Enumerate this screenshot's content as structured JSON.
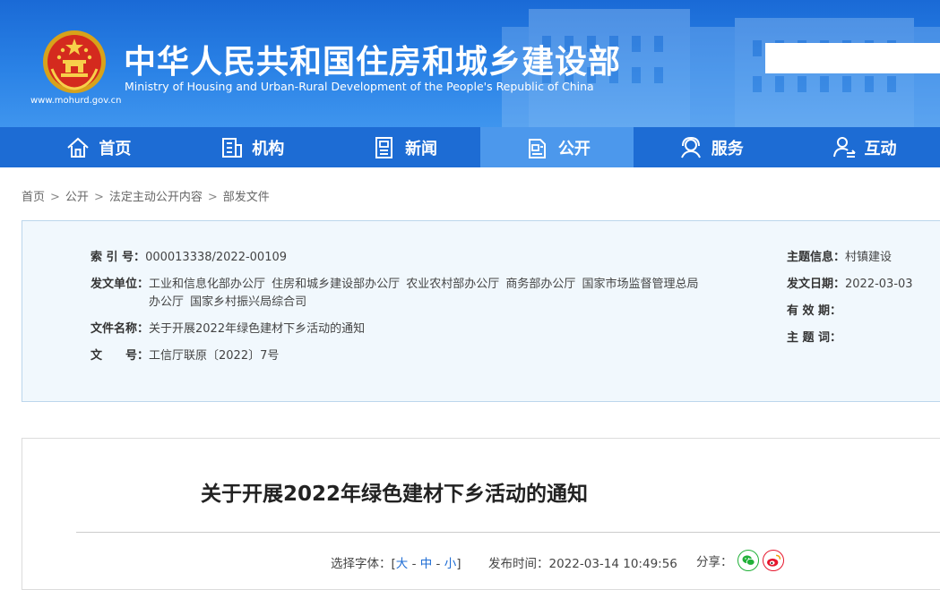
{
  "header": {
    "title_cn": "中华人民共和国住房和城乡建设部",
    "title_en": "Ministry of Housing and Urban-Rural Development of the People's Republic of China",
    "site_url": "www.mohurd.gov.cn",
    "search_placeholder": ""
  },
  "nav": {
    "items": [
      {
        "label": "首页",
        "icon": "home-icon"
      },
      {
        "label": "机构",
        "icon": "building-icon"
      },
      {
        "label": "新闻",
        "icon": "news-icon"
      },
      {
        "label": "公开",
        "icon": "document-icon",
        "active": true
      },
      {
        "label": "服务",
        "icon": "service-icon"
      },
      {
        "label": "互动",
        "icon": "interaction-icon"
      }
    ]
  },
  "breadcrumb": {
    "items": [
      "首页",
      "公开",
      "法定主动公开内容",
      "部发文件"
    ],
    "separator": ">"
  },
  "info": {
    "index_label": "索 引 号：",
    "index_value": "000013338/2022-00109",
    "issuer_label": "发文单位：",
    "issuer_value": "工业和信息化部办公厅  住房和城乡建设部办公厅  农业农村部办公厅  商务部办公厅  国家市场监督管理总局办公厅  国家乡村振兴局综合司",
    "filename_label": "文件名称：",
    "filename_value": "关于开展2022年绿色建材下乡活动的通知",
    "docno_label": "文　　号：",
    "docno_value": "工信厅联原〔2022〕7号",
    "topic_label": "主题信息：",
    "topic_value": "村镇建设",
    "date_label": "发文日期：",
    "date_value": "2022-03-03",
    "valid_label": "有 效 期：",
    "valid_value": "",
    "keywords_label": "主 题 词：",
    "keywords_value": ""
  },
  "article": {
    "title": "关于开展2022年绿色建材下乡活动的通知",
    "font_label": "选择字体：[",
    "font_large": "大",
    "font_medium": "中",
    "font_small": "小",
    "font_dash": " - ",
    "font_close": "]",
    "publish_label": "发布时间：",
    "publish_value": "2022-03-14 10:49:56",
    "share_label": "分享："
  },
  "colors": {
    "banner": "#1a6ad6",
    "nav": "#1d6cd4",
    "nav_active": "#4c98ec",
    "wechat": "#20b038",
    "weibo": "#e6162d"
  }
}
